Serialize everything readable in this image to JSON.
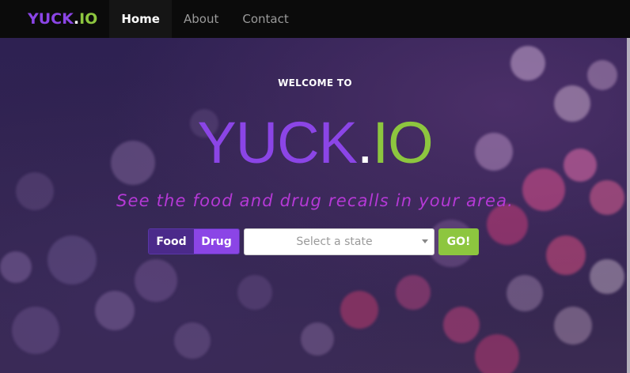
{
  "navbar": {
    "brand": {
      "part1": "YUCK",
      "part2": ".",
      "part3": "IO"
    },
    "items": [
      {
        "label": "Home",
        "active": true
      },
      {
        "label": "About",
        "active": false
      },
      {
        "label": "Contact",
        "active": false
      }
    ]
  },
  "hero": {
    "welcome": "WELCOME TO",
    "logo": {
      "part1": "YUCK",
      "part2": ".",
      "part3": "IO"
    },
    "tagline": "See the food and drug recalls in your area."
  },
  "search": {
    "toggle": {
      "food_label": "Food",
      "drug_label": "Drug",
      "selected": "Drug"
    },
    "state_placeholder": "Select a state",
    "go_label": "GO!"
  },
  "colors": {
    "brand_purple": "#8b45e6",
    "brand_green": "#8dc63f",
    "tagline_magenta": "#b539d6",
    "navbar_bg": "#0b0b0b"
  }
}
